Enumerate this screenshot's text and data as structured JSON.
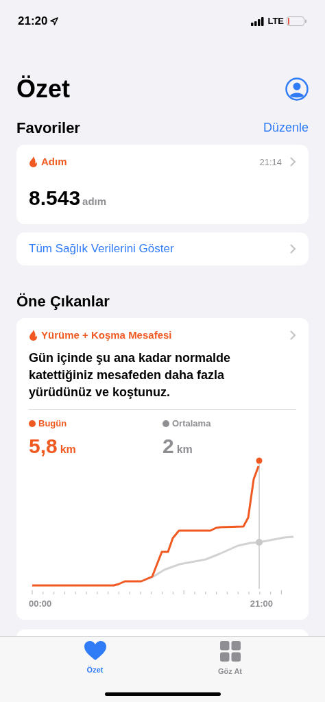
{
  "status_bar": {
    "time": "21:20",
    "network": "LTE"
  },
  "header": {
    "title": "Özet"
  },
  "favorites": {
    "title": "Favoriler",
    "action": "Düzenle",
    "cards": [
      {
        "metric": "Adım",
        "time": "21:14",
        "value": "8.543",
        "unit": "adım"
      }
    ],
    "show_all": "Tüm Sağlık Verilerini Göster"
  },
  "highlights": {
    "title": "Öne Çıkanlar",
    "card": {
      "metric": "Yürüme + Koşma Mesafesi",
      "text": "Gün içinde şu ana kadar normalde katettiğiniz mesafeden daha fazla yürüdünüz ve koştunuz.",
      "stats": [
        {
          "label": "Bugün",
          "value": "5,8",
          "unit": "km",
          "color": "#f05a22"
        },
        {
          "label": "Ortalama",
          "value": "2",
          "unit": "km",
          "color": "#8e8e93"
        }
      ],
      "x_labels": [
        "00:00",
        "21:00"
      ]
    }
  },
  "tab_bar": [
    {
      "label": "Özet",
      "kind": "heart",
      "selected": true
    },
    {
      "label": "Göz At",
      "kind": "grid",
      "selected": false
    }
  ]
}
